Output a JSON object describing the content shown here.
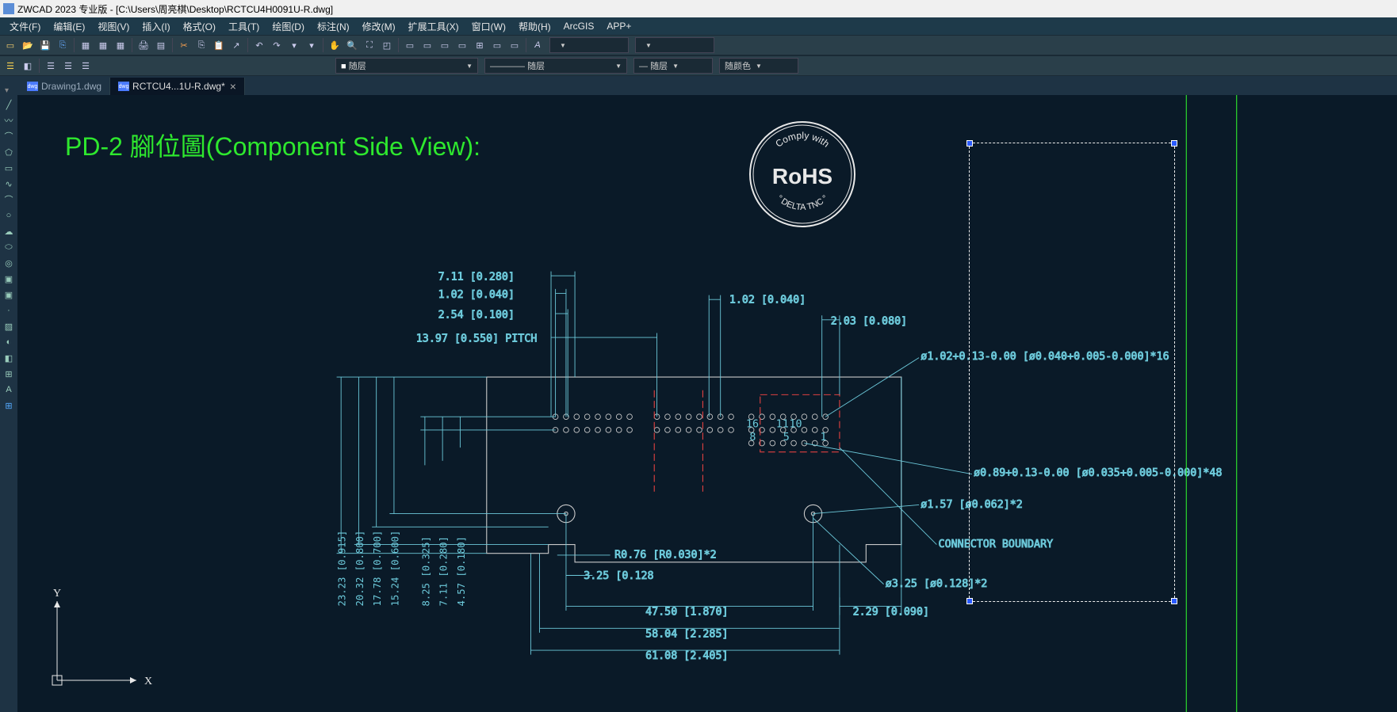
{
  "title": "ZWCAD 2023 专业版 - [C:\\Users\\周亮棋\\Desktop\\RCTCU4H0091U-R.dwg]",
  "menu": {
    "file": "文件(F)",
    "edit": "编辑(E)",
    "view": "视图(V)",
    "insert": "插入(I)",
    "format": "格式(O)",
    "tools": "工具(T)",
    "draw": "绘图(D)",
    "dimension": "标注(N)",
    "modify": "修改(M)",
    "ext": "扩展工具(X)",
    "window": "窗口(W)",
    "help": "帮助(H)",
    "arcgis": "ArcGIS",
    "app": "APP+"
  },
  "layer": {
    "prop1": "随层",
    "prop2": "随层",
    "prop3": "随层",
    "color": "随颜色"
  },
  "tabs": {
    "t1": "Drawing1.dwg",
    "t2": "RCTCU4...1U-R.dwg*"
  },
  "drawing": {
    "title": "PD-2  腳位圖(Component Side View):",
    "rohs": {
      "top": "Comply    with",
      "main": "RoHS",
      "bottom": "° DELTA  TNC °"
    },
    "dims": {
      "d1": "7.11 [0.280]",
      "d2": "1.02 [0.040]",
      "d3": "2.54 [0.100]",
      "d4": "13.97 [0.550] PITCH",
      "d5": "1.02 [0.040]",
      "d6": "2.03 [0.080]",
      "d7": "ø1.02+0.13-0.00 [ø0.040+0.005-0.000]*16",
      "d8": "ø0.89+0.13-0.00 [ø0.035+0.005-0.000]*48",
      "d9": "ø1.57 [ø0.062]*2",
      "d10": "CONNECTOR BOUNDARY",
      "d11": "ø3.25 [ø0.128]*2",
      "d12": "2.29 [0.090]",
      "d13": "R0.76 [R0.030]*2",
      "d14": "3.25 [0.128",
      "d15": "47.50 [1.870]",
      "d16": "58.04 [2.285]",
      "d17": "61.08 [2.405]",
      "v1": "23.23 [0.915]",
      "v2": "20.32 [0.800]",
      "v3": "17.78 [0.700]",
      "v4": "15.24 [0.600]",
      "v5": "8.25 [0.325]",
      "v6": "7.11 [0.280]",
      "v7": "4.57 [0.180]"
    },
    "pins": {
      "p1": "1",
      "p5": "5",
      "p8": "8",
      "p10": "10",
      "p11": "11",
      "p16": "16"
    },
    "axes": {
      "x": "X",
      "y": "Y"
    }
  }
}
